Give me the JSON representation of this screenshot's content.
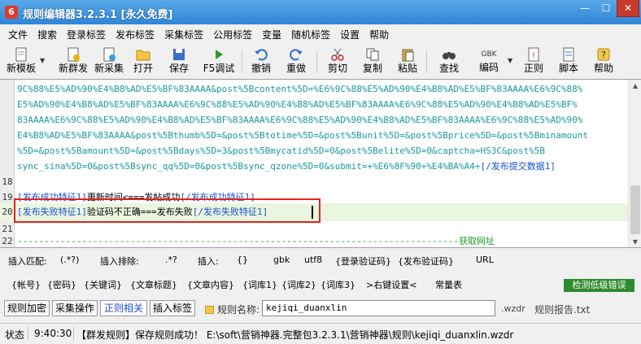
{
  "window": {
    "title": "规则编辑器3.2.3.1 [永久免费]",
    "min": "—",
    "max": "☐",
    "close": "✕"
  },
  "menu": [
    "文件",
    "搜索",
    "登录标签",
    "发布标签",
    "采集标签",
    "公用标签",
    "变量",
    "随机标签",
    "设置",
    "帮助"
  ],
  "toolbar": {
    "new_template": "新模板",
    "new_publish": "新群发",
    "new_collect": "新采集",
    "open": "打开",
    "save": "保存",
    "debug": "F5调试",
    "undo": "撤销",
    "redo": "重做",
    "cut": "剪切",
    "copy": "复制",
    "paste": "粘贴",
    "find": "查找",
    "encoding": "编码",
    "encoding_badge": "GBK",
    "regex": "正则",
    "script": "脚本",
    "help": "帮助"
  },
  "editor": {
    "wrapped_lines": [
      "9C%88%E5%AD%90%E4%B8%AD%E5%BF%83AAAA&post%5Bcontent%5D=%E6%9C%88%E5%AD%90%E4%B8%AD%E5%BF%83AAAA%E6%9C%88%",
      "E5%AD%90%E4%B8%AD%E5%BF%83AAAA%E6%9C%88%E5%AD%90%E4%B8%AD%E5%BF%83AAAA%E6%9C%88%E5%AD%90%E4%B8%AD%E5%BF%",
      "83AAAA%E6%9C%88%E5%AD%90%E4%B8%AD%E5%BF%83AAAA%E6%9C%88%E5%AD%90%E4%B8%AD%E5%BF%83AAAA%E6%9C%88%E5%AD%90%",
      "E4%B8%AD%E5%BF%83AAAA&post%5Bthumb%5D=&post%5Btotime%5D=&post%5Bunit%5D=&post%5Bprice%5D=&post%5Bminamount",
      "%5D=&post%5Bamount%5D=&post%5Bdays%5D=3&post%5Bmycatid%5D=0&post%5Belite%5D=0&captcha=HS3C&post%5B",
      "sync_sina%5D=0&post%5Bsync_qq%5D=0&post%5Bsync_qzone%5D=0&submit=+%E6%8F%90+%E4%BA%A4+"
    ],
    "submit_tag": "[/发布提交数据1]",
    "line_numbers": [
      "18",
      "19",
      "20",
      "21",
      "22"
    ],
    "line19": {
      "open": "[发布成功特征1]",
      "text": "更新时间<===发帖成功",
      "close": "[/发布成功特征1]"
    },
    "line20": {
      "open": "[发布失败特征1]",
      "text": "验证码不正确===发布失败",
      "close": "[/发布失败特征1]"
    },
    "line22": {
      "dashes": "----------------------------------------------------------------------------------",
      "label": "获取网址"
    }
  },
  "insert": {
    "match_label": "插入匹配:",
    "match_value": "(.*?)",
    "exclude_label": "插入排除:",
    "exclude_value": ".*?",
    "insert_label": "插入:",
    "braces": "{}",
    "gbk": "gbk",
    "utf8": "utf8",
    "login_captcha": "{登录验证码}",
    "publish_captcha": "{发布验证码}",
    "url": "URL"
  },
  "tags": {
    "account": "{帐号}",
    "password": "{密码}",
    "keyword": "{关键词}",
    "article_title": "{文章标题}",
    "article_content": "{文章内容}",
    "lib1": "{词库1}",
    "lib2": "{词库2}",
    "lib3": "{词库3}",
    "keyword_settings": ">右键设置<",
    "common": "常量表",
    "check_errors": "检测低级错误"
  },
  "tabs": {
    "encrypt": "规则加密",
    "collect_ops": "采集操作",
    "regex": "正则相关",
    "insert_tags": "插入标签"
  },
  "rule_name": {
    "label": "规则名称:",
    "value": "kejiqi_duanxlin",
    "ext": ".wzdr",
    "report": "规则报告.txt"
  },
  "status": {
    "label": "状态",
    "time": "9:40:30",
    "message": "【群发规则】保存规则成功！ E:\\soft\\营销神器.完整包3.2.3.1\\营销神器\\规则\\kejiqi_duanxlin.wzdr"
  },
  "colors": {
    "title_bar": "#2f86d6",
    "highlight_box": "#e0251e",
    "check_button": "#2e8b2e",
    "tag_blue": "#1a4fd0",
    "url_teal": "#1a9a9a"
  }
}
